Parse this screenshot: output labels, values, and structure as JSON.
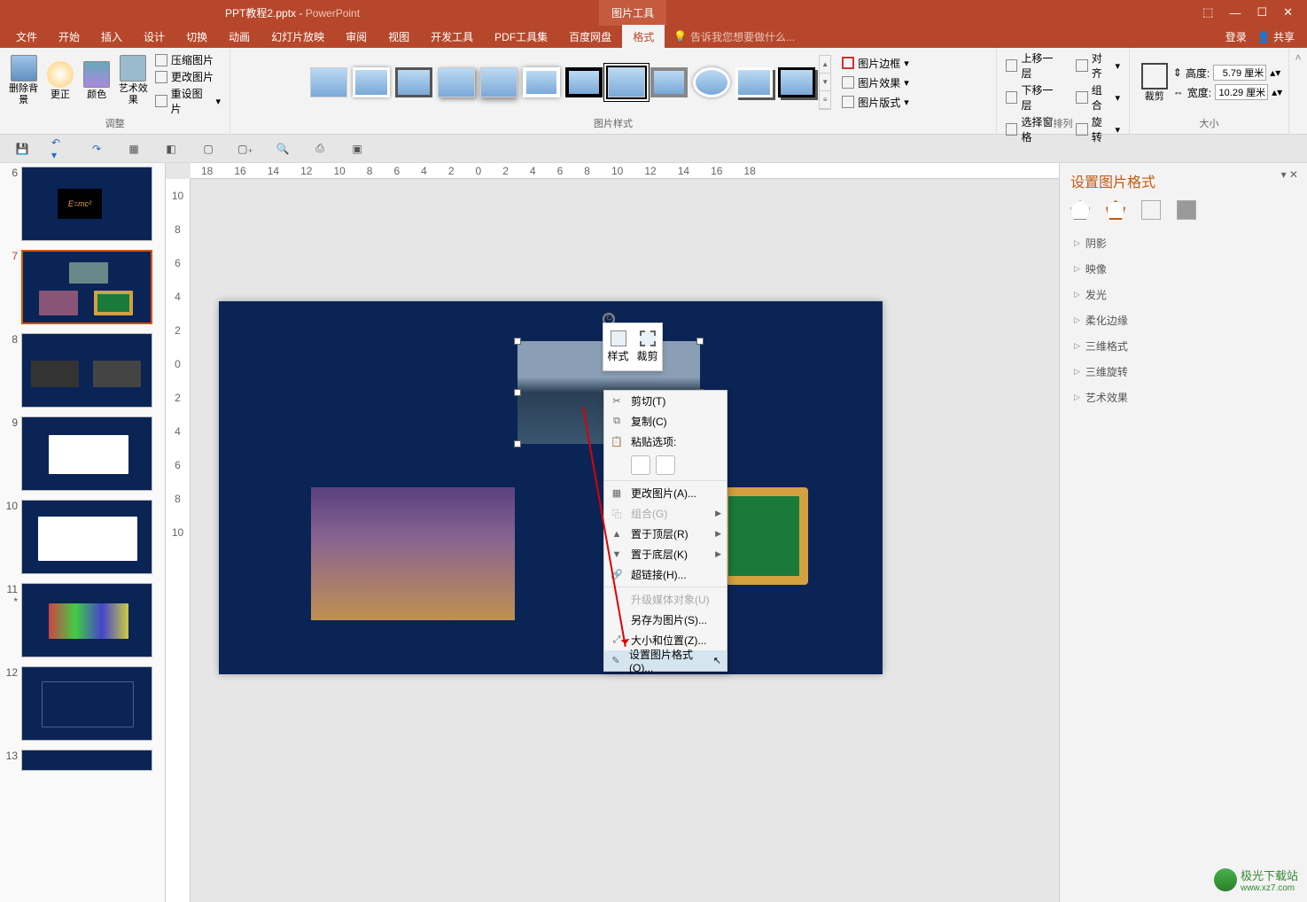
{
  "titlebar": {
    "filename": "PPT教程2.pptx",
    "appname": "PowerPoint",
    "context_tab": "图片工具"
  },
  "window_buttons": {
    "min": "—",
    "max": "☐",
    "close": "✕",
    "opts": "⬚"
  },
  "tabs": [
    "文件",
    "开始",
    "插入",
    "设计",
    "切换",
    "动画",
    "幻灯片放映",
    "审阅",
    "视图",
    "开发工具",
    "PDF工具集",
    "百度网盘",
    "格式"
  ],
  "active_tab": "格式",
  "tellme": "告诉我您想要做什么...",
  "account": {
    "login": "登录",
    "share": "共享"
  },
  "ribbon": {
    "adjust": {
      "label": "调整",
      "remove_bg": "删除背景",
      "corrections": "更正",
      "color": "颜色",
      "artistic": "艺术效果",
      "compress": "压缩图片",
      "change": "更改图片",
      "reset": "重设图片"
    },
    "styles": {
      "label": "图片样式",
      "border": "图片边框",
      "effects": "图片效果",
      "layout": "图片版式"
    },
    "arrange": {
      "label": "排列",
      "forward": "上移一层",
      "backward": "下移一层",
      "selection": "选择窗格",
      "align": "对齐",
      "group": "组合",
      "rotate": "旋转"
    },
    "size": {
      "label": "大小",
      "crop": "裁剪",
      "height_label": "高度:",
      "width_label": "宽度:",
      "height": "5.79 厘米",
      "width": "10.29 厘米"
    }
  },
  "slides": [
    {
      "n": "6"
    },
    {
      "n": "7",
      "active": true
    },
    {
      "n": "8"
    },
    {
      "n": "9"
    },
    {
      "n": "10"
    },
    {
      "n": "11",
      "dirty": "*"
    },
    {
      "n": "12"
    },
    {
      "n": "13"
    }
  ],
  "ruler_h": [
    "18",
    "16",
    "14",
    "12",
    "10",
    "8",
    "6",
    "4",
    "2",
    "0",
    "2",
    "4",
    "6",
    "8",
    "10",
    "12",
    "14",
    "16",
    "18"
  ],
  "ruler_v": [
    "10",
    "8",
    "6",
    "4",
    "2",
    "0",
    "2",
    "4",
    "6",
    "8",
    "10"
  ],
  "minitoolbar": {
    "style": "样式",
    "crop": "裁剪"
  },
  "context_menu": {
    "cut": "剪切(T)",
    "copy": "复制(C)",
    "paste_label": "粘贴选项:",
    "change": "更改图片(A)...",
    "group": "组合(G)",
    "front": "置于顶层(R)",
    "back": "置于底层(K)",
    "link": "超链接(H)...",
    "media": "升级媒体对象(U)",
    "saveas": "另存为图片(S)...",
    "sizepos": "大小和位置(Z)...",
    "format": "设置图片格式(O)..."
  },
  "sidepanel": {
    "title": "设置图片格式",
    "sections": [
      "阴影",
      "映像",
      "发光",
      "柔化边缘",
      "三维格式",
      "三维旋转",
      "艺术效果"
    ]
  },
  "watermark": {
    "text": "极光下载站",
    "url": "www.xz7.com"
  }
}
